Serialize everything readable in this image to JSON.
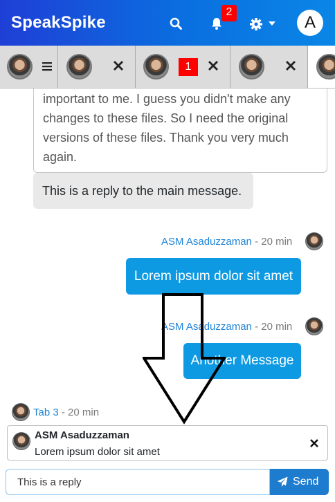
{
  "header": {
    "brand": "SpeakSpike",
    "notification_count": "2",
    "user_initial": "A",
    "colors": {
      "gradient_start": "#1f3fd6",
      "gradient_end": "#0a86e6"
    },
    "icons": [
      "search-icon",
      "bell-icon",
      "gear-icon",
      "caret-down-icon"
    ]
  },
  "tabs": {
    "items": [
      {
        "name": "main",
        "has_menu": true,
        "active": false
      },
      {
        "name": "tab-2",
        "closable": true,
        "active": false
      },
      {
        "name": "tab-3",
        "closable": true,
        "unread": "1",
        "active": false
      },
      {
        "name": "tab-4",
        "closable": true,
        "active": false
      },
      {
        "name": "tab-5",
        "active": true
      }
    ]
  },
  "chat": {
    "quoted_message": {
      "lines": [
        "important to me. I guess you didn't make any",
        "changes to these files. So I need the original",
        "versions of these files. Thank you very much",
        "again."
      ]
    },
    "reply_message": "This is a reply to the main message.",
    "messages": [
      {
        "author": "ASM Asaduzzaman",
        "separator": " - ",
        "time": "20 min",
        "text": "Lorem ipsum dolor sit amet"
      },
      {
        "author": "ASM Asaduzzaman",
        "separator": " - ",
        "time": "20 min",
        "text": "Another Message"
      }
    ]
  },
  "reply_context": {
    "author": "Tab 3",
    "separator": " - ",
    "time": "20 min",
    "preview_name": "ASM Asaduzzaman",
    "preview_text": "Lorem ipsum dolor sit amet"
  },
  "composer": {
    "value": "This is a reply",
    "send_label": "Send",
    "accent": "#1e7ccf"
  }
}
